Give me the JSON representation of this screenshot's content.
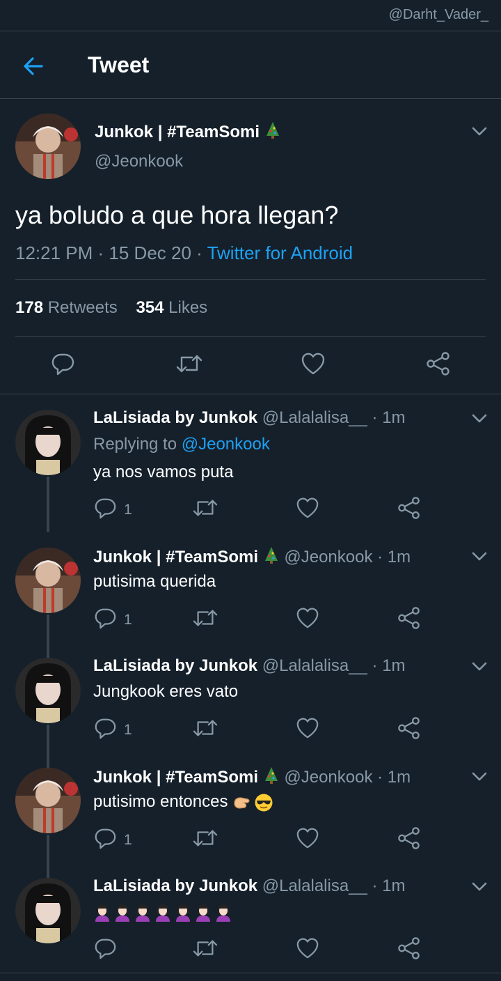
{
  "watermark": "@Darht_Vader_",
  "header": {
    "title": "Tweet"
  },
  "tweet": {
    "author_name": "Junkok | #TeamSomi",
    "author_handle": "@Jeonkook",
    "text": "ya boludo a que hora llegan?",
    "time": "12:21 PM · 15 Dec 20 · ",
    "source": "Twitter for Android",
    "retweets_count": "178",
    "retweets_label": " Retweets",
    "likes_count": "354",
    "likes_label": " Likes"
  },
  "replies": [
    {
      "name": "LaLisiada by Junkok",
      "handle": " @Lalalalisa__ · 1m",
      "replying_prefix": "Replying to ",
      "replying_to": "@Jeonkook",
      "text": "ya nos vamos puta",
      "reply_count": "1"
    },
    {
      "name": "Junkok | #TeamSomi",
      "handle": "@Jeonkook · 1m",
      "text": "putisima querida",
      "reply_count": "1"
    },
    {
      "name": "LaLisiada by Junkok",
      "handle": " @Lalalalisa__ · 1m",
      "text": "Jungkook eres vato",
      "reply_count": "1"
    },
    {
      "name": "Junkok | #TeamSomi",
      "handle": "@Jeonkook · 1m",
      "text": "putisimo entonces",
      "reply_count": "1"
    },
    {
      "name": "LaLisiada by Junkok",
      "handle": " @Lalalalisa__ · 1m",
      "text": ""
    }
  ],
  "icons": {
    "back": "back-arrow-icon",
    "reply": "reply-icon",
    "retweet": "retweet-icon",
    "like": "heart-icon",
    "share": "share-icon",
    "more": "chevron-down-icon",
    "tree": "christmas-tree-emoji",
    "pinch": "pinching-hand-emoji",
    "cool": "sunglasses-emoji",
    "woman": "woman-emoji"
  },
  "colors": {
    "background": "#15202b",
    "accent": "#1da1f2",
    "muted": "#8899a6",
    "divider": "#38444d"
  }
}
